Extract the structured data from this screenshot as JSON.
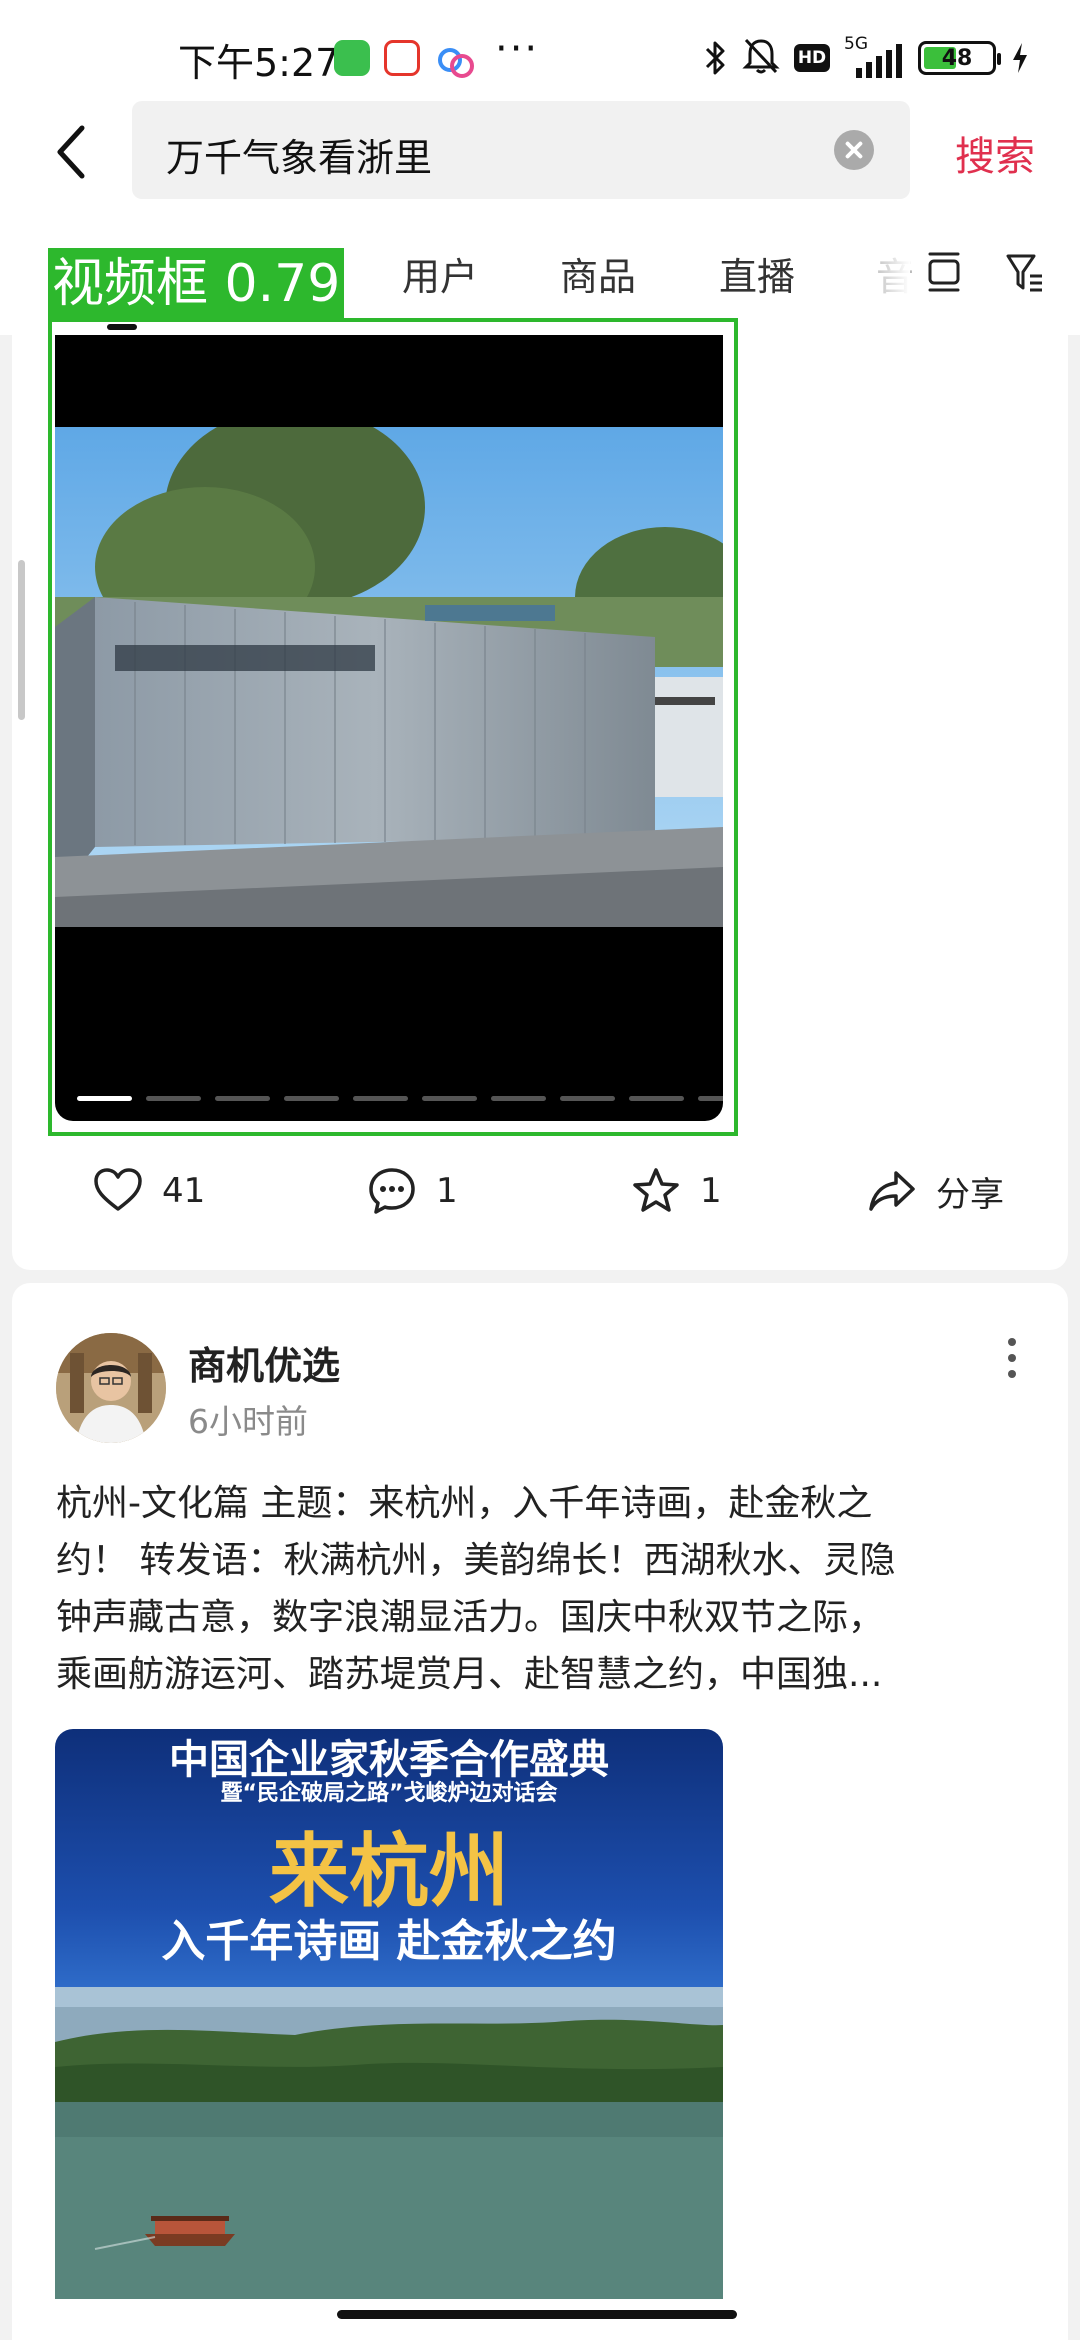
{
  "status_bar": {
    "time": "下午5:27",
    "app_icons": [
      "cat-app-icon",
      "58-app-icon",
      "cloud-app-icon"
    ],
    "more": "···",
    "hd": "HD",
    "network": "5G",
    "battery": "48",
    "battery_level": 0.48
  },
  "search": {
    "query": "万千气象看浙里",
    "submit_label": "搜索"
  },
  "tabs": [
    {
      "label": "视频"
    },
    {
      "label": "用户"
    },
    {
      "label": "商品"
    },
    {
      "label": "直播"
    },
    {
      "label": "音"
    }
  ],
  "detection": {
    "label": "视频框 0.79",
    "color": "#2db82d"
  },
  "post1": {
    "video_progress": {
      "segments": 10,
      "current": 1
    },
    "likes": "41",
    "comments": "1",
    "favorites": "1",
    "share_label": "分享"
  },
  "post2": {
    "author": "商机优选",
    "time": "6小时前",
    "text_lines": [
      "杭州-文化篇 主题：来杭州，入千年诗画，赴金秋之",
      "约！ 转发语：秋满杭州，美韵绵长！西湖秋水、灵隐",
      "钟声藏古意，数字浪潮显活力。国庆中秋双节之际，",
      "乘画舫游运河、踏苏堤赏月、赴智慧之约，中国独..."
    ],
    "poster": {
      "line1": "中国企业家秋季合作盛典",
      "line2": "暨“民企破局之路”戈峻炉边对话会",
      "line3": "来杭州",
      "line4": "入千年诗画 赴金秋之约"
    }
  },
  "colors": {
    "accent": "#e0304e",
    "detection": "#2db82d"
  }
}
